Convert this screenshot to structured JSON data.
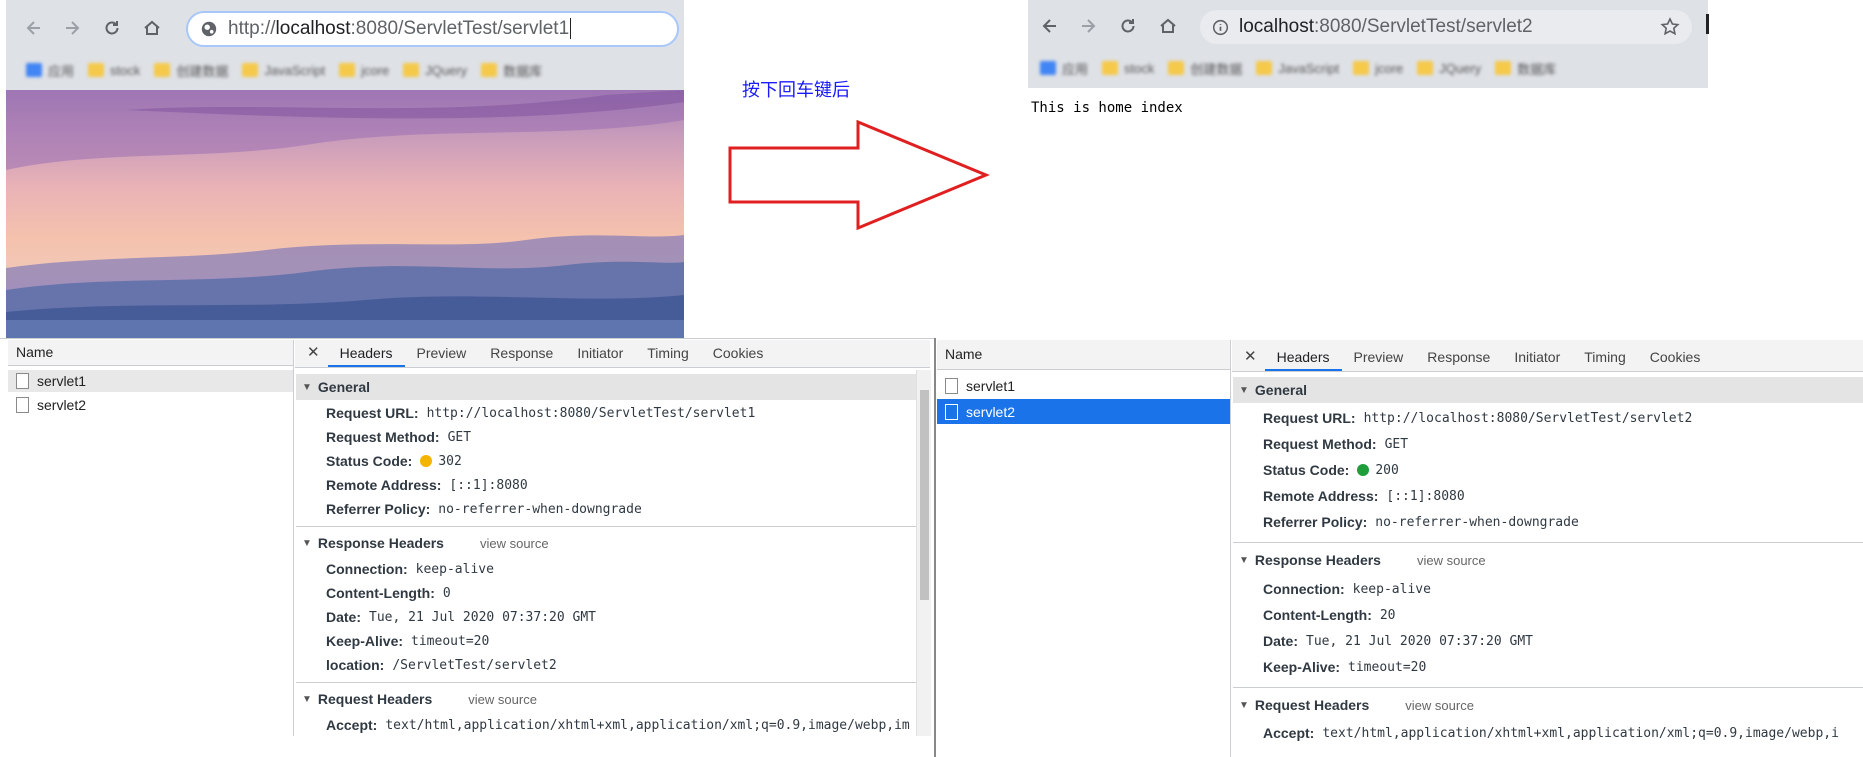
{
  "left_browser": {
    "url_prefix": "http://",
    "url_host": "localhost",
    "url_rest": ":8080/ServletTest/servlet1",
    "bookmarks": [
      "应用",
      "stock",
      "创建数据",
      "JavaScript",
      "jcore",
      "JQuery",
      "数据库"
    ]
  },
  "right_browser": {
    "url_host": "localhost",
    "url_rest": ":8080/ServletTest/servlet2",
    "page_text": "This is home index",
    "bookmarks": [
      "应用",
      "stock",
      "创建数据",
      "JavaScript",
      "jcore",
      "JQuery",
      "数据库"
    ]
  },
  "annotation": {
    "label": "按下回车键后",
    "arrow_color": "#e02020",
    "label_color": "#1a1aff"
  },
  "left_devtools": {
    "name_header": "Name",
    "requests": [
      "servlet1",
      "servlet2"
    ],
    "tabs": [
      "Headers",
      "Preview",
      "Response",
      "Initiator",
      "Timing",
      "Cookies"
    ],
    "general_title": "General",
    "general": [
      {
        "k": "Request URL:",
        "v": "http://localhost:8080/ServletTest/servlet1"
      },
      {
        "k": "Request Method:",
        "v": "GET"
      },
      {
        "k": "Status Code:",
        "v": "302",
        "status_color": "#f5b400"
      },
      {
        "k": "Remote Address:",
        "v": "[::1]:8080"
      },
      {
        "k": "Referrer Policy:",
        "v": "no-referrer-when-downgrade"
      }
    ],
    "response_title": "Response Headers",
    "view_source": "view source",
    "response": [
      {
        "k": "Connection:",
        "v": "keep-alive"
      },
      {
        "k": "Content-Length:",
        "v": "0"
      },
      {
        "k": "Date:",
        "v": "Tue, 21 Jul 2020 07:37:20 GMT"
      },
      {
        "k": "Keep-Alive:",
        "v": "timeout=20"
      },
      {
        "k": "location:",
        "v": "/ServletTest/servlet2"
      }
    ],
    "request_title": "Request Headers",
    "request": [
      {
        "k": "Accept:",
        "v": "text/html,application/xhtml+xml,application/xml;q=0.9,image/webp,im"
      }
    ]
  },
  "right_devtools": {
    "name_header": "Name",
    "requests": [
      "servlet1",
      "servlet2"
    ],
    "tabs": [
      "Headers",
      "Preview",
      "Response",
      "Initiator",
      "Timing",
      "Cookies"
    ],
    "general_title": "General",
    "general": [
      {
        "k": "Request URL:",
        "v": "http://localhost:8080/ServletTest/servlet2"
      },
      {
        "k": "Request Method:",
        "v": "GET"
      },
      {
        "k": "Status Code:",
        "v": "200",
        "status_color": "#1e9e3a"
      },
      {
        "k": "Remote Address:",
        "v": "[::1]:8080"
      },
      {
        "k": "Referrer Policy:",
        "v": "no-referrer-when-downgrade"
      }
    ],
    "response_title": "Response Headers",
    "view_source": "view source",
    "response": [
      {
        "k": "Connection:",
        "v": "keep-alive"
      },
      {
        "k": "Content-Length:",
        "v": "20"
      },
      {
        "k": "Date:",
        "v": "Tue, 21 Jul 2020 07:37:20 GMT"
      },
      {
        "k": "Keep-Alive:",
        "v": "timeout=20"
      }
    ],
    "request_title": "Request Headers",
    "request": [
      {
        "k": "Accept:",
        "v": "text/html,application/xhtml+xml,application/xml;q=0.9,image/webp,i"
      }
    ]
  }
}
